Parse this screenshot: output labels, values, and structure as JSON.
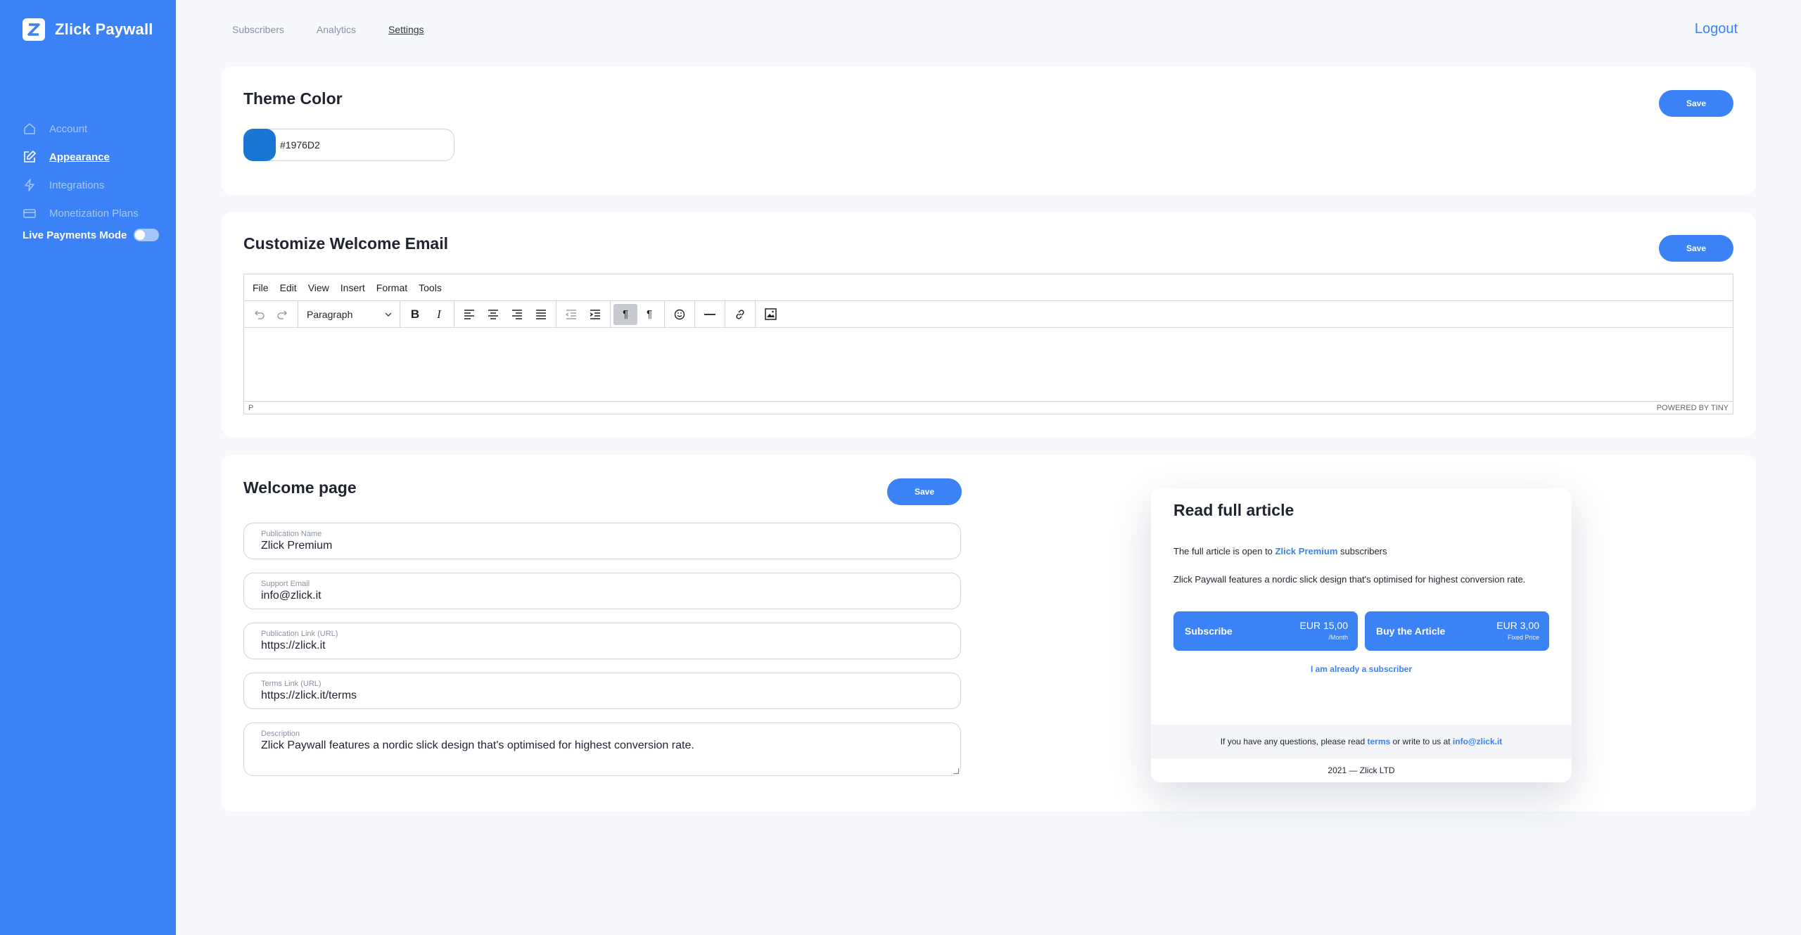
{
  "brand": {
    "name": "Zlick Paywall"
  },
  "sidebar": {
    "items": [
      {
        "label": "Account",
        "icon": "home-icon"
      },
      {
        "label": "Appearance",
        "icon": "edit-icon",
        "active": true
      },
      {
        "label": "Integrations",
        "icon": "bolt-icon"
      },
      {
        "label": "Monetization Plans",
        "icon": "card-icon"
      }
    ],
    "live_label": "Live Payments Mode"
  },
  "topnav": {
    "items": [
      "Subscribers",
      "Analytics",
      "Settings"
    ],
    "active": "Settings",
    "logout": "Logout"
  },
  "theme": {
    "title": "Theme Color",
    "value": "#1976D2",
    "swatch": "#1976D2",
    "save": "Save"
  },
  "email": {
    "title": "Customize Welcome Email",
    "save": "Save",
    "menu": [
      "File",
      "Edit",
      "View",
      "Insert",
      "Format",
      "Tools"
    ],
    "block_format": "Paragraph",
    "status_path": "P",
    "powered": "POWERED BY TINY"
  },
  "welcome": {
    "title": "Welcome page",
    "save": "Save",
    "fields": [
      {
        "label": "Publication Name",
        "value": "Zlick Premium"
      },
      {
        "label": "Support Email",
        "value": "info@zlick.it"
      },
      {
        "label": "Publication Link (URL)",
        "value": "https://zlick.it"
      },
      {
        "label": "Terms Link (URL)",
        "value": "https://zlick.it/terms"
      },
      {
        "label": "Description",
        "value": "Zlick Paywall features a nordic slick design that's optimised for highest conversion rate."
      }
    ]
  },
  "preview": {
    "title": "Read full article",
    "open_prefix": "The full article is open to",
    "open_name": "Zlick Premium",
    "open_suffix": "subscribers",
    "description": "Zlick Paywall features a nordic slick design that's optimised for highest conversion rate.",
    "subscribe": {
      "label": "Subscribe",
      "price": "EUR 15,00",
      "sub": "/Month"
    },
    "buy": {
      "label": "Buy the Article",
      "price": "EUR 3,00",
      "sub": "Fixed Price"
    },
    "already": "I am already a subscriber",
    "footer_prefix": "If you have any questions, please read",
    "footer_terms": "terms",
    "footer_mid": "or write to us at",
    "footer_email": "info@zlick.it",
    "copyright": "2021 — Zlick LTD"
  },
  "colors": {
    "accent": "#3b82f6",
    "sidebar": "#3b82f6",
    "background": "#f6f8fb"
  }
}
